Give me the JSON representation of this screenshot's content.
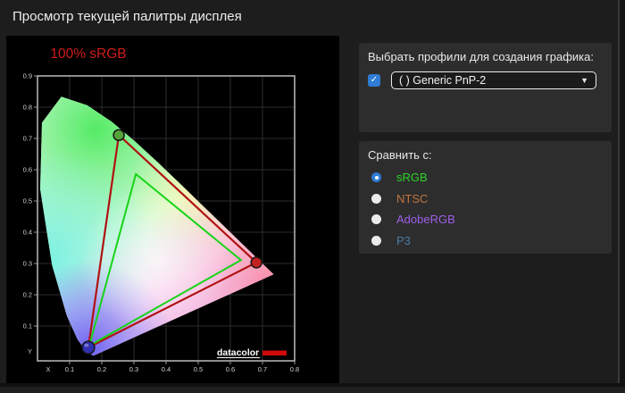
{
  "window": {
    "title": "Просмотр текущей палитры дисплея"
  },
  "profiles_box": {
    "heading": "Выбрать профили для создания графика:",
    "checkbox_checked": true,
    "dropdown_value": "( ) Generic PnP-2"
  },
  "compare_box": {
    "heading": "Сравнить с:",
    "options": [
      {
        "label": "sRGB",
        "color": "#2bd52b",
        "selected": true
      },
      {
        "label": "NTSC",
        "color": "#c0763f",
        "selected": false
      },
      {
        "label": "AdobeRGB",
        "color": "#9d5fe8",
        "selected": false
      },
      {
        "label": "P3",
        "color": "#4b7da6",
        "selected": false
      }
    ]
  },
  "accent_color": "#2e7cd6",
  "chart_data": {
    "type": "area",
    "title": "CIE chromaticity diagram",
    "annotation": "100% sRGB",
    "annotation_color": "#d01c1c",
    "watermark": "datacolor",
    "watermark_bar_color": "#cf0a0a",
    "x_axis_title": "X",
    "y_axis_title": "Y",
    "x_tick_labels": [
      "0.1",
      "0.2",
      "0.3",
      "0.4",
      "0.5",
      "0.6",
      "0.7",
      "0.8"
    ],
    "y_tick_labels": [
      "0.9",
      "0.8",
      "0.7",
      "0.6",
      "0.5",
      "0.4",
      "0.3",
      "0.2",
      "0.1"
    ],
    "xlim": [
      0,
      0.8
    ],
    "ylim": [
      0,
      0.9
    ],
    "grid": true,
    "series": [
      {
        "name": "display-gamut",
        "color": "#b01212",
        "points": [
          [
            0.253,
            0.711
          ],
          [
            0.681,
            0.303
          ],
          [
            0.158,
            0.031
          ]
        ]
      },
      {
        "name": "sRGB-reference",
        "color": "#16d416",
        "points": [
          [
            0.306,
            0.586
          ],
          [
            0.633,
            0.311
          ],
          [
            0.161,
            0.037
          ]
        ]
      }
    ],
    "primary_markers": [
      {
        "name": "green-primary",
        "x": 0.253,
        "y": 0.711,
        "color": "#55a33a",
        "r": 6
      },
      {
        "name": "red-primary",
        "x": 0.681,
        "y": 0.303,
        "color": "#c32020",
        "r": 6
      },
      {
        "name": "blue-primary",
        "x": 0.158,
        "y": 0.031,
        "color": "#3231b2",
        "r": 7
      }
    ],
    "spectral_locus": [
      [
        0.1741,
        0.005
      ],
      [
        0.1644,
        0.0109
      ],
      [
        0.1566,
        0.0177
      ],
      [
        0.144,
        0.0297
      ],
      [
        0.1241,
        0.0578
      ],
      [
        0.0913,
        0.1327
      ],
      [
        0.0454,
        0.295
      ],
      [
        0.0082,
        0.5384
      ],
      [
        0.0139,
        0.7502
      ],
      [
        0.0743,
        0.8338
      ],
      [
        0.1547,
        0.8059
      ],
      [
        0.2296,
        0.7543
      ],
      [
        0.3016,
        0.6923
      ],
      [
        0.3731,
        0.6245
      ],
      [
        0.4441,
        0.5547
      ],
      [
        0.5125,
        0.4866
      ],
      [
        0.5752,
        0.4242
      ],
      [
        0.627,
        0.3725
      ],
      [
        0.6658,
        0.334
      ],
      [
        0.6915,
        0.3083
      ],
      [
        0.719,
        0.2809
      ],
      [
        0.7347,
        0.2653
      ]
    ]
  }
}
